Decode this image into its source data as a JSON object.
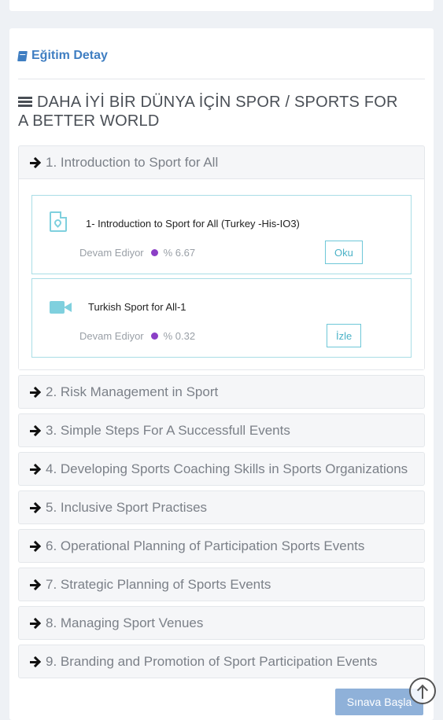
{
  "panel": {
    "header": "Eğitim Detay",
    "course_title": "DAHA İYİ BİR DÜNYA İÇİN SPOR / SPORTS FOR A BETTER WORLD"
  },
  "modules": [
    {
      "label": "1. Introduction to Sport for All"
    },
    {
      "label": "2. Risk Management in Sport"
    },
    {
      "label": "3. Simple Steps For A Successfull Events"
    },
    {
      "label": "4. Developing Sports Coaching Skills in Sports Organizations"
    },
    {
      "label": "5. Inclusive Sport Practises"
    },
    {
      "label": "6. Operational Planning of Participation Sports Events"
    },
    {
      "label": "7. Strategic Planning of Sports Events"
    },
    {
      "label": "8. Managing Sport Venues"
    },
    {
      "label": "9. Branding and Promotion of Sport Participation Events"
    }
  ],
  "lessons": [
    {
      "title": "1- Introduction to Sport for All (Turkey -His-IO3)",
      "status": "Devam Ediyor",
      "progress": "% 6.67",
      "action": "Oku",
      "icon": "pdf-icon",
      "status_color": "#8b3fc6"
    },
    {
      "title": "Turkish Sport for All-1",
      "status": "Devam Ediyor",
      "progress": "% 0.32",
      "action": "İzle",
      "icon": "video-icon",
      "status_color": "#8b3fc6"
    }
  ],
  "footer": {
    "exam_button": "Sınava Başla"
  },
  "colors": {
    "accent": "#3f7ec2",
    "teal": "#4bb2c7",
    "exam_button": "#8fb1d9"
  }
}
